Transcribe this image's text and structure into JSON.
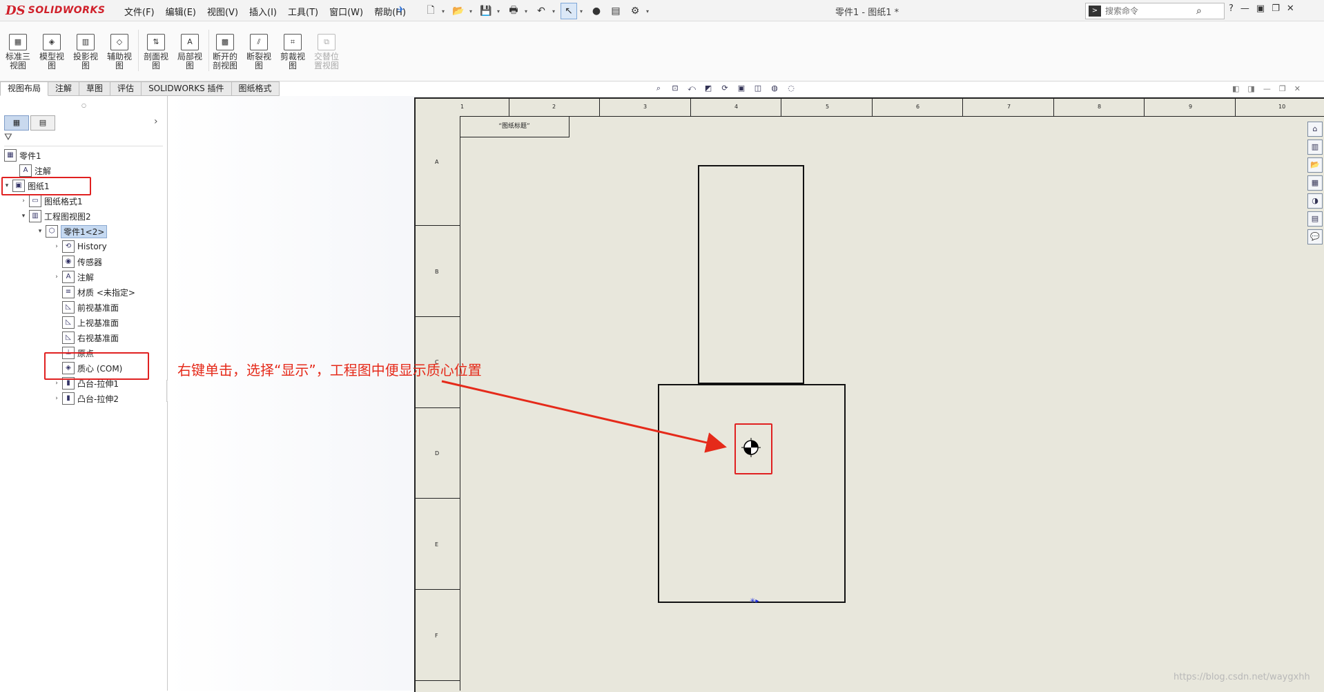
{
  "app": {
    "logo_ds": "DS",
    "logo_text": "SOLIDWORKS",
    "doc_title": "零件1 - 图纸1 *"
  },
  "menu": [
    "文件(F)",
    "编辑(E)",
    "视图(V)",
    "插入(I)",
    "工具(T)",
    "窗口(W)",
    "帮助(H)"
  ],
  "quick_access": [
    "new-icon",
    "open-icon",
    "save-icon",
    "print-icon",
    "undo-icon",
    "select-icon",
    "traffic-light-icon",
    "file-properties-icon",
    "options-icon"
  ],
  "search": {
    "placeholder": "搜索命令"
  },
  "ribbon": {
    "buttons": [
      {
        "label": "标准三视图",
        "disabled": false
      },
      {
        "label": "模型视图",
        "disabled": false
      },
      {
        "label": "投影视图",
        "disabled": false
      },
      {
        "label": "辅助视图",
        "disabled": false
      },
      {
        "label": "剖面视图",
        "disabled": false
      },
      {
        "label": "局部视图",
        "disabled": false
      },
      {
        "label": "断开的剖视图",
        "disabled": false
      },
      {
        "label": "断裂视图",
        "disabled": false
      },
      {
        "label": "剪裁视图",
        "disabled": false
      },
      {
        "label": "交替位置视图",
        "disabled": true
      }
    ],
    "tabs": [
      "视图布局",
      "注解",
      "草图",
      "评估",
      "SOLIDWORKS 插件",
      "图纸格式"
    ],
    "active_tab": "视图布局"
  },
  "tree": {
    "nodes": [
      {
        "label": "零件1",
        "icon": "drawing-icon"
      },
      {
        "label": "注解",
        "icon": "annotation-icon"
      },
      {
        "label": "图纸1",
        "icon": "sheet-icon"
      },
      {
        "label": "图纸格式1",
        "icon": "sheet-format-icon"
      },
      {
        "label": "工程图视图2",
        "icon": "drawing-view-icon"
      },
      {
        "label": "零件1<2>",
        "icon": "part-icon"
      },
      {
        "label": "History",
        "icon": "history-icon"
      },
      {
        "label": "传感器",
        "icon": "sensor-icon"
      },
      {
        "label": "注解",
        "icon": "annotation-icon"
      },
      {
        "label": "材质 <未指定>",
        "icon": "material-icon"
      },
      {
        "label": "前视基准面",
        "icon": "plane-icon"
      },
      {
        "label": "上视基准面",
        "icon": "plane-icon"
      },
      {
        "label": "右视基准面",
        "icon": "plane-icon"
      },
      {
        "label": "原点",
        "icon": "origin-icon"
      },
      {
        "label": "质心 (COM)",
        "icon": "center-of-mass-icon"
      },
      {
        "label": "凸台-拉伸1",
        "icon": "extrude-icon"
      },
      {
        "label": "凸台-拉伸2",
        "icon": "extrude-icon"
      }
    ]
  },
  "drawing": {
    "title_block_text": "“图纸标题”",
    "zone_numbers": [
      "1",
      "2",
      "3",
      "4",
      "5",
      "6",
      "7",
      "8",
      "9",
      "10"
    ],
    "zone_letters": [
      "A",
      "B",
      "C",
      "D",
      "E",
      "F"
    ]
  },
  "annotation": {
    "text": "右键单击，选择“显示”，工程图中便显示质心位置",
    "color": "#e52a1a"
  },
  "watermark": "https://blog.csdn.net/waygxhh",
  "colors": {
    "highlight_red": "#e02020",
    "selection_blue": "#c5d9f1",
    "sheet_bg": "#e8e7dc"
  }
}
